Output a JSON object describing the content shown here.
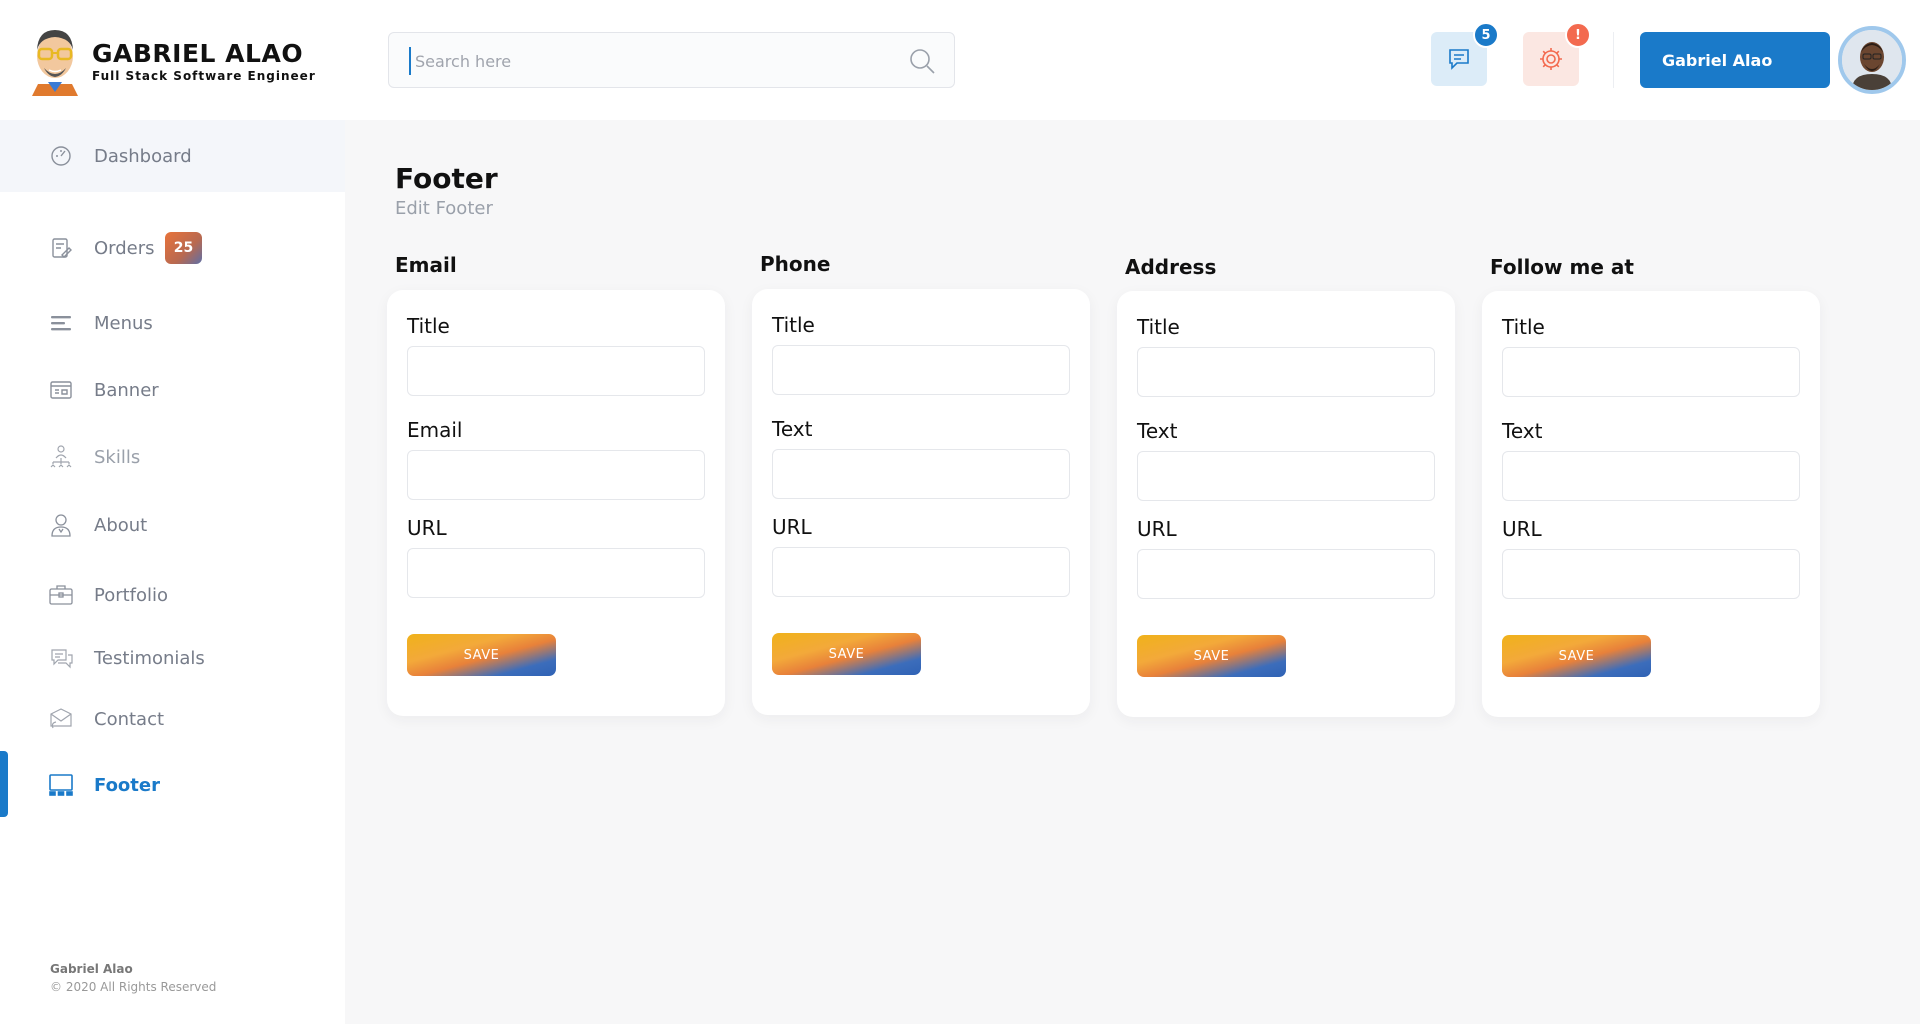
{
  "brand": {
    "name": "GABRIEL ALAO",
    "subtitle": "Full Stack Software Engineer"
  },
  "search": {
    "placeholder": "Search here"
  },
  "notifications": {
    "messages_count": "5",
    "alerts_count": "!"
  },
  "user": {
    "name": "Gabriel Alao"
  },
  "sidebar": {
    "items": [
      {
        "label": "Dashboard",
        "icon": "dashboard-icon"
      },
      {
        "label": "Orders",
        "icon": "orders-icon",
        "badge": "25"
      },
      {
        "label": "Menus",
        "icon": "menu-icon"
      },
      {
        "label": "Banner",
        "icon": "banner-icon"
      },
      {
        "label": "Skills",
        "icon": "skills-icon"
      },
      {
        "label": "About",
        "icon": "about-icon"
      },
      {
        "label": "Portfolio",
        "icon": "portfolio-icon"
      },
      {
        "label": "Testimonials",
        "icon": "testimonials-icon"
      },
      {
        "label": "Contact",
        "icon": "contact-icon"
      },
      {
        "label": "Footer",
        "icon": "footer-icon",
        "active": true
      }
    ],
    "footer": {
      "name": "Gabriel Alao",
      "copyright": "© 2020 All Rights Reserved"
    }
  },
  "page": {
    "title": "Footer",
    "subtitle": "Edit Footer"
  },
  "sections": [
    {
      "title": "Email",
      "fields": [
        "Title",
        "Email",
        "URL"
      ],
      "save_label": "SAVE"
    },
    {
      "title": "Phone",
      "fields": [
        "Title",
        "Text",
        "URL"
      ],
      "save_label": "SAVE"
    },
    {
      "title": "Address",
      "fields": [
        "Title",
        "Text",
        "URL"
      ],
      "save_label": "SAVE"
    },
    {
      "title": "Follow me at",
      "fields": [
        "Title",
        "Text",
        "URL"
      ],
      "save_label": "SAVE"
    }
  ],
  "colors": {
    "accent": "#1a7ac9",
    "alert": "#f36a4f",
    "background": "#f7f7f8"
  }
}
